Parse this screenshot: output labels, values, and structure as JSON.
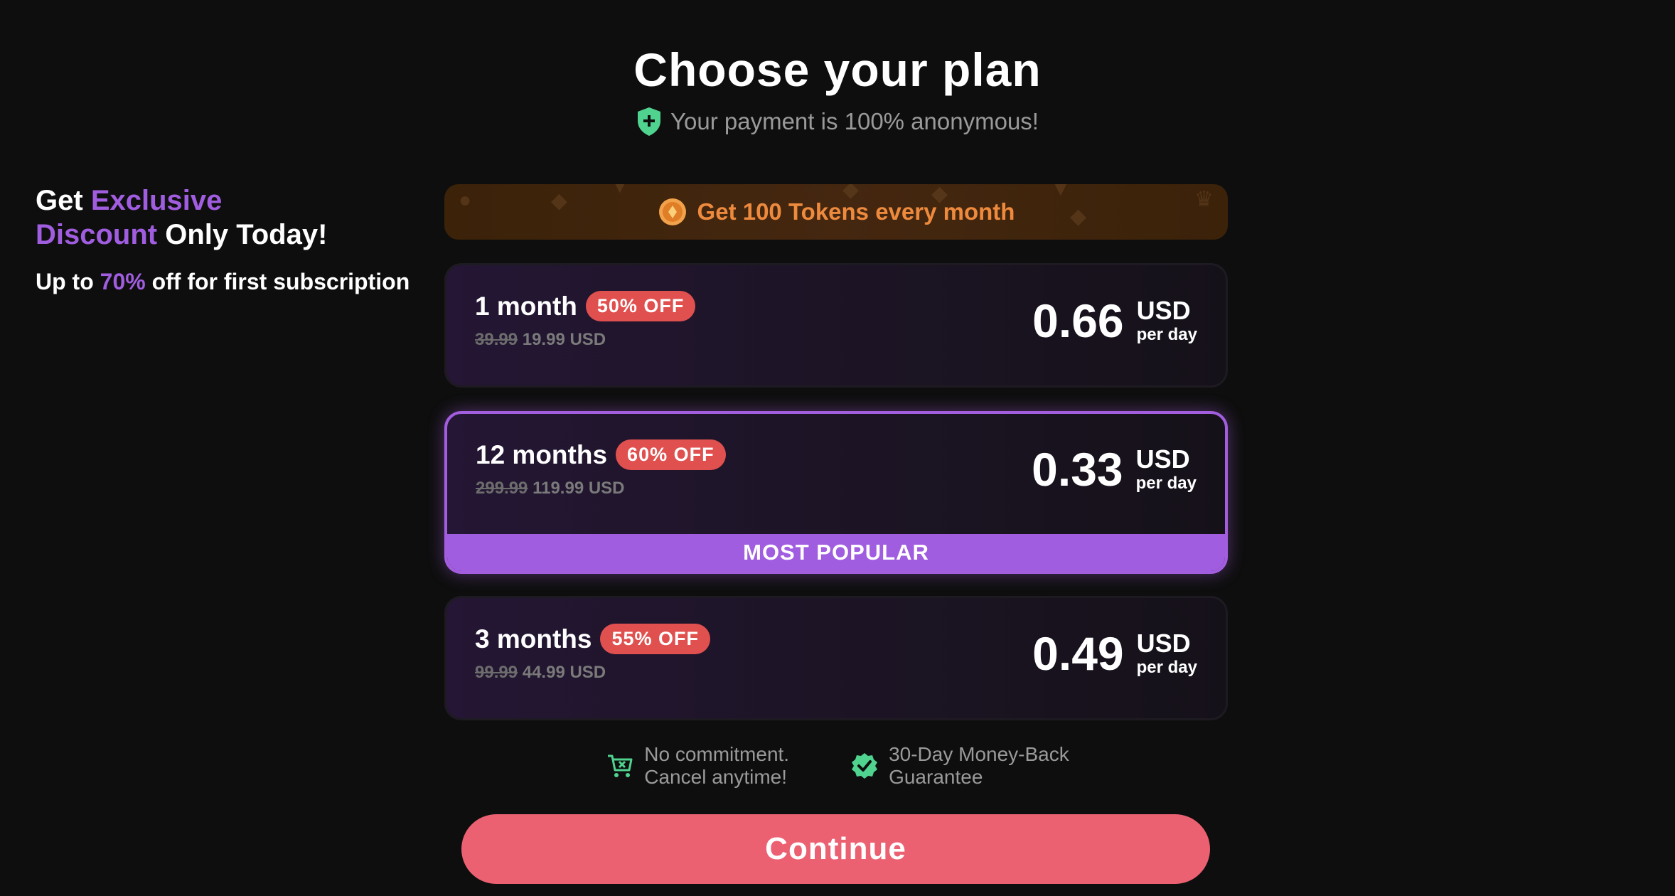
{
  "header": {
    "title": "Choose your plan",
    "subtitle": "Your payment is 100% anonymous!",
    "subtitle_icon": "shield-plus-icon"
  },
  "promo": {
    "line1_prefix": "Get",
    "line1_highlight": "Exclusive",
    "line2_highlight": "Discount",
    "line2_suffix": "Only Today!",
    "sub_prefix": "Up to",
    "sub_highlight": "70%",
    "sub_suffix": "off for first subscription"
  },
  "tokens_banner": {
    "label": "Get 100 Tokens every month",
    "icon": "coin-icon"
  },
  "plans": [
    {
      "name": "1 month",
      "badge": "50% OFF",
      "old_price": "39.99",
      "new_price": "19.99 USD",
      "price_per_day": "0.66",
      "currency": "USD",
      "per": "per day",
      "selected": false
    },
    {
      "name": "12 months",
      "badge": "60% OFF",
      "old_price": "299.99",
      "new_price": "119.99 USD",
      "price_per_day": "0.33",
      "currency": "USD",
      "per": "per day",
      "selected": true,
      "ribbon": "MOST POPULAR"
    },
    {
      "name": "3 months",
      "badge": "55% OFF",
      "old_price": "99.99",
      "new_price": "44.99 USD",
      "price_per_day": "0.49",
      "currency": "USD",
      "per": "per day",
      "selected": false
    }
  ],
  "assurances": [
    {
      "icon": "cart-x-icon",
      "line1": "No commitment.",
      "line2": "Cancel anytime!"
    },
    {
      "icon": "verified-check-icon",
      "line1": "30-Day Money-Back",
      "line2": "Guarantee"
    }
  ],
  "cta": {
    "label": "Continue"
  },
  "colors": {
    "background": "#0e0e0e",
    "accent_purple": "#a15de0",
    "badge_red": "#e0504f",
    "cta_pink": "#ec6172",
    "token_orange": "#ee8a3d",
    "icon_green": "#4fd38f"
  }
}
